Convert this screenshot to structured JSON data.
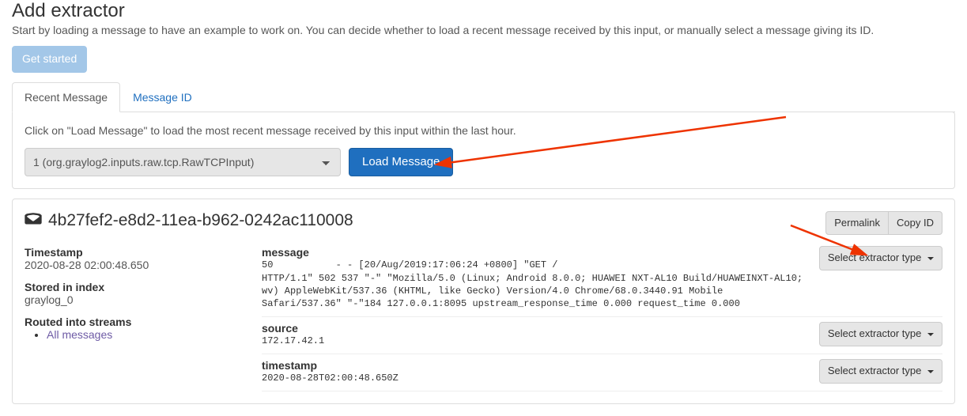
{
  "header": {
    "title": "Add extractor",
    "intro": "Start by loading a message to have an example to work on. You can decide whether to load a recent message received by this input, or manually select a message giving its ID.",
    "get_started": "Get started"
  },
  "tabs": {
    "recent": "Recent Message",
    "message_id": "Message ID"
  },
  "loader": {
    "hint": "Click on \"Load Message\" to load the most recent message received by this input within the last hour.",
    "input_option": "1 (org.graylog2.inputs.raw.tcp.RawTCPInput)",
    "load_button": "Load Message"
  },
  "result": {
    "id": "4b27fef2-e8d2-11ea-b962-0242ac110008",
    "header_buttons": {
      "permalink": "Permalink",
      "copy_id": "Copy ID"
    },
    "meta": {
      "timestamp_label": "Timestamp",
      "timestamp_value": "2020-08-28 02:00:48.650",
      "index_label": "Stored in index",
      "index_value": "graylog_0",
      "streams_label": "Routed into streams",
      "stream_link": "All messages"
    },
    "select_extractor_label": "Select extractor type",
    "fields": [
      {
        "name": "message",
        "value": "50           - - [20/Aug/2019:17:06:24 +0800] \"GET /                                       HTTP/1.1\" 502 537 \"-\" \"Mozilla/5.0 (Linux; Android 8.0.0; HUAWEI NXT-AL10 Build/HUAWEINXT-AL10; wv) AppleWebKit/537.36 (KHTML, like Gecko) Version/4.0 Chrome/68.0.3440.91 Mobile Safari/537.36\" \"-\"184 127.0.0.1:8095 upstream_response_time 0.000 request_time 0.000"
      },
      {
        "name": "source",
        "value": "172.17.42.1"
      },
      {
        "name": "timestamp",
        "value": "2020-08-28T02:00:48.650Z"
      }
    ]
  }
}
